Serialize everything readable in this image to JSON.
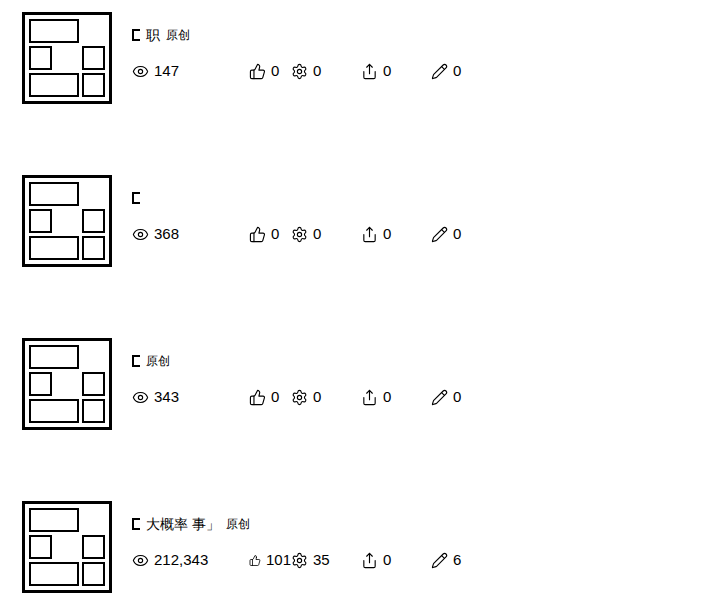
{
  "articles": [
    {
      "title": "职",
      "badge": "原创",
      "stats": {
        "views": "147",
        "likes": "0",
        "favorites": "0",
        "shares": "0",
        "comments": "0"
      }
    },
    {
      "title": "",
      "badge": "",
      "stats": {
        "views": "368",
        "likes": "0",
        "favorites": "0",
        "shares": "0",
        "comments": "0"
      }
    },
    {
      "title": "",
      "badge": "原创",
      "stats": {
        "views": "343",
        "likes": "0",
        "favorites": "0",
        "shares": "0",
        "comments": "0"
      }
    },
    {
      "title": "大概率 事」",
      "badge": "原创",
      "stats": {
        "views": "212,343",
        "likes": "101",
        "favorites": "35",
        "shares": "0",
        "comments": "6"
      }
    }
  ]
}
